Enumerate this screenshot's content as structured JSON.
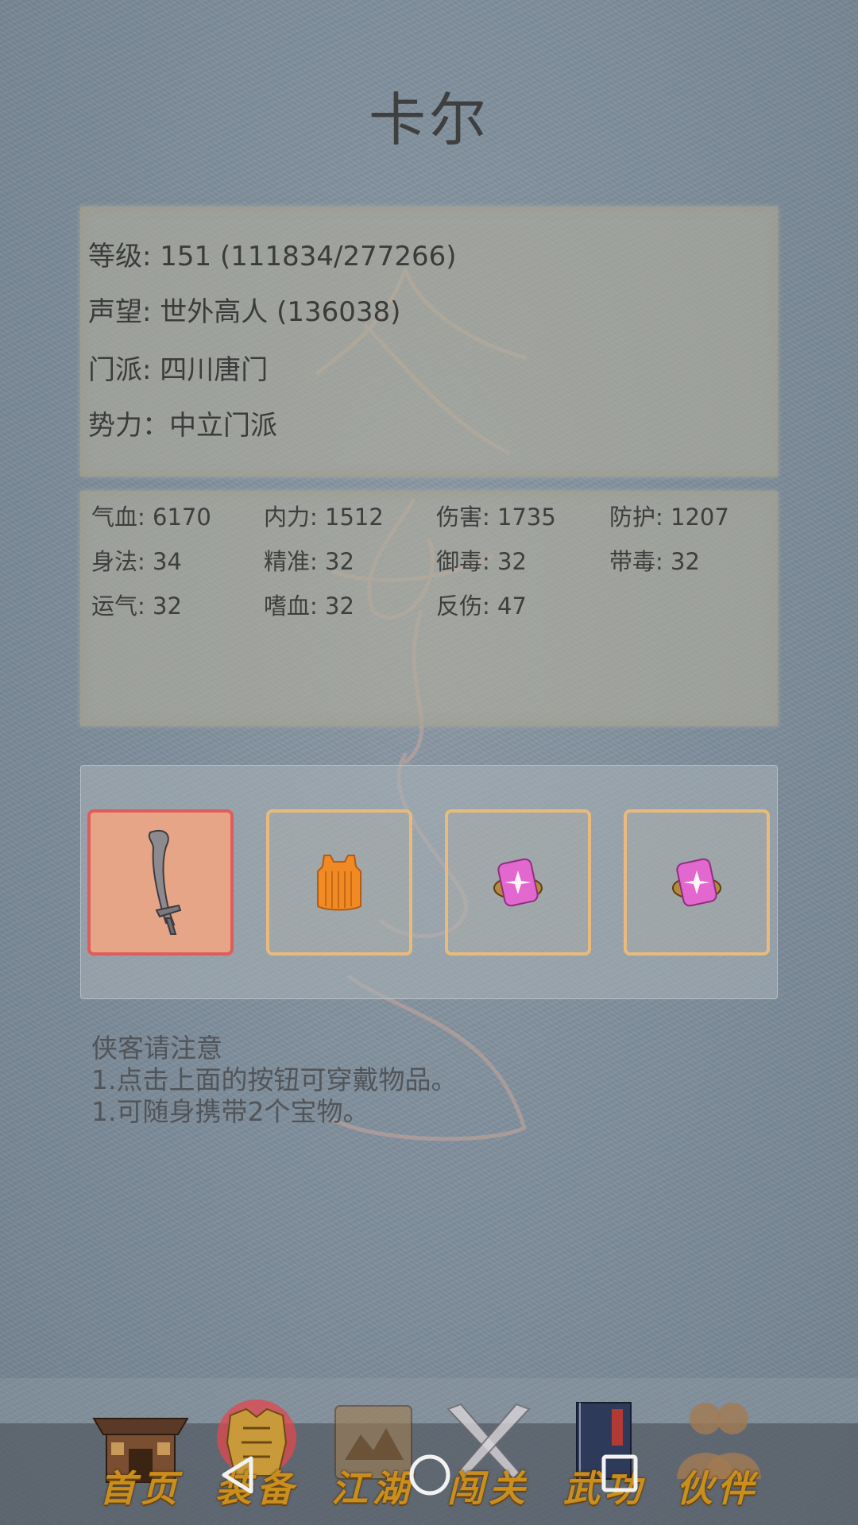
{
  "character": {
    "name": "卡尔"
  },
  "info": {
    "level": "等级: 151 (111834/277266)",
    "reputation": "声望: 世外高人 (136038)",
    "sect": "门派: 四川唐门",
    "faction": "势力：中立门派"
  },
  "stats": [
    "气血: 6170",
    "内力: 1512",
    "伤害: 1735",
    "防护: 1207",
    "身法: 34",
    "精准: 32",
    "御毒: 32",
    "带毒: 32",
    "运气: 32",
    "嗜血: 32",
    "反伤: 47"
  ],
  "equipment": {
    "slots": [
      {
        "item": "sword-icon",
        "selected": true
      },
      {
        "item": "orange-armor-icon",
        "selected": false
      },
      {
        "item": "pink-charm-icon",
        "selected": false
      },
      {
        "item": "pink-charm-icon",
        "selected": false
      }
    ]
  },
  "notes": {
    "heading": "侠客请注意",
    "line1": "1.点击上面的按钮可穿戴物品。",
    "line2": "1.可随身携带2个宝物。"
  },
  "tabs": [
    {
      "label": "首页",
      "icon": "house-icon"
    },
    {
      "label": "装备",
      "icon": "armor-icon",
      "active": true
    },
    {
      "label": "江湖",
      "icon": "scroll-map-icon"
    },
    {
      "label": "闯关",
      "icon": "crossed-swords-icon"
    },
    {
      "label": "武功",
      "icon": "book-icon"
    },
    {
      "label": "伙伴",
      "icon": "companions-icon"
    }
  ],
  "colors": {
    "background": "#7e8d9b",
    "panel": "#b0ac9c",
    "slot_border": "#e8bb7c",
    "slot_selected_border": "#e05c5c",
    "tab_label": "#c98e1c"
  }
}
